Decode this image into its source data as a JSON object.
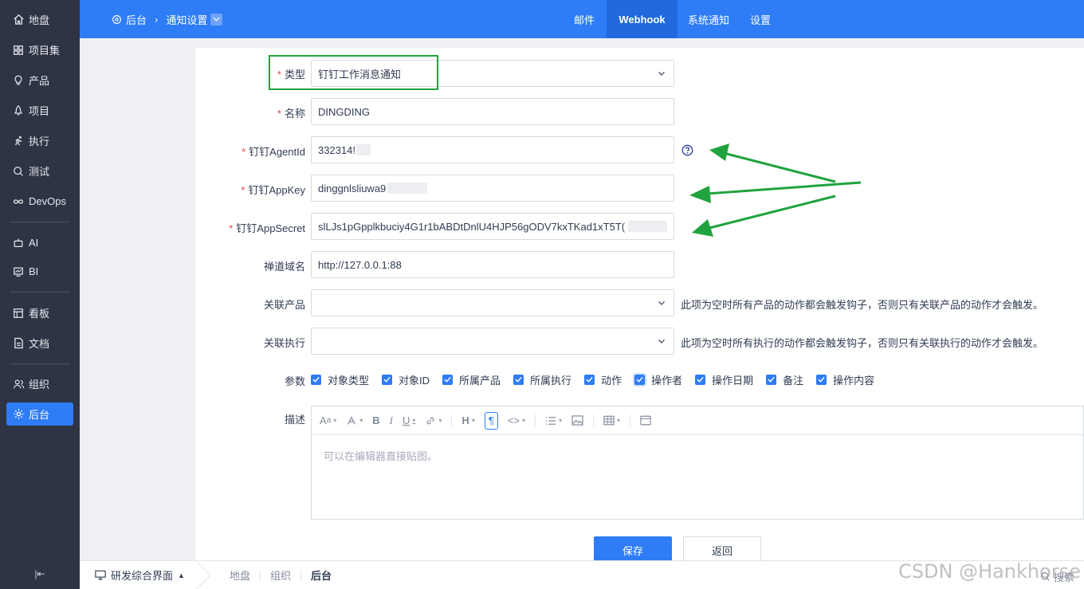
{
  "sidebar": {
    "items": [
      {
        "label": "地盘",
        "icon": "home-icon"
      },
      {
        "label": "项目集",
        "icon": "grid-icon"
      },
      {
        "label": "产品",
        "icon": "lightbulb-icon"
      },
      {
        "label": "项目",
        "icon": "rocket-icon"
      },
      {
        "label": "执行",
        "icon": "run-icon"
      },
      {
        "label": "测试",
        "icon": "search-icon"
      },
      {
        "label": "DevOps",
        "icon": "infinity-icon"
      },
      {
        "label": "AI",
        "icon": "robot-icon"
      },
      {
        "label": "BI",
        "icon": "chart-icon"
      },
      {
        "label": "看板",
        "icon": "kanban-icon"
      },
      {
        "label": "文档",
        "icon": "document-icon"
      },
      {
        "label": "组织",
        "icon": "users-icon"
      },
      {
        "label": "后台",
        "icon": "gear-icon",
        "active": true
      }
    ]
  },
  "header": {
    "breadcrumb_root": "后台",
    "breadcrumb_current": "通知设置",
    "tabs": [
      "邮件",
      "Webhook",
      "系统通知",
      "设置"
    ],
    "active_tab": "Webhook"
  },
  "form": {
    "type_label": "类型",
    "type_value": "钉钉工作消息通知",
    "name_label": "名称",
    "name_value": "DINGDING",
    "agentid_label": "钉钉AgentId",
    "agentid_value": "332314!",
    "appkey_label": "钉钉AppKey",
    "appkey_value": "dinggnlsliuwa9",
    "appsecret_label": "钉钉AppSecret",
    "appsecret_value": "slLJs1pGpplkbuciy4G1r1bABDtDnlU4HJP56gODV7kxTKad1xT5T(",
    "domain_label": "禅道域名",
    "domain_value": "http://127.0.0.1:88",
    "product_label": "关联产品",
    "product_hint": "此项为空时所有产品的动作都会触发钩子，否则只有关联产品的动作才会触发。",
    "execution_label": "关联执行",
    "execution_hint": "此项为空时所有执行的动作都会触发钩子，否则只有关联执行的动作才会触发。",
    "params_label": "参数",
    "params": [
      "对象类型",
      "对象ID",
      "所属产品",
      "所属执行",
      "动作",
      "操作者",
      "操作日期",
      "备注",
      "操作内容"
    ],
    "desc_label": "描述",
    "editor_placeholder": "可以在编辑器直接贴图。",
    "save_label": "保存",
    "back_label": "返回"
  },
  "bottom": {
    "switch_label": "研发综合界面",
    "links": [
      "地盘",
      "组织",
      "后台"
    ],
    "current": "后台",
    "search_label": "搜索"
  },
  "watermark": "CSDN @Hankhorse",
  "colors": {
    "accent": "#2e7cf6",
    "sidebar_bg": "#2e3444",
    "annotation_green": "#21a33f",
    "required": "#e5464b"
  }
}
